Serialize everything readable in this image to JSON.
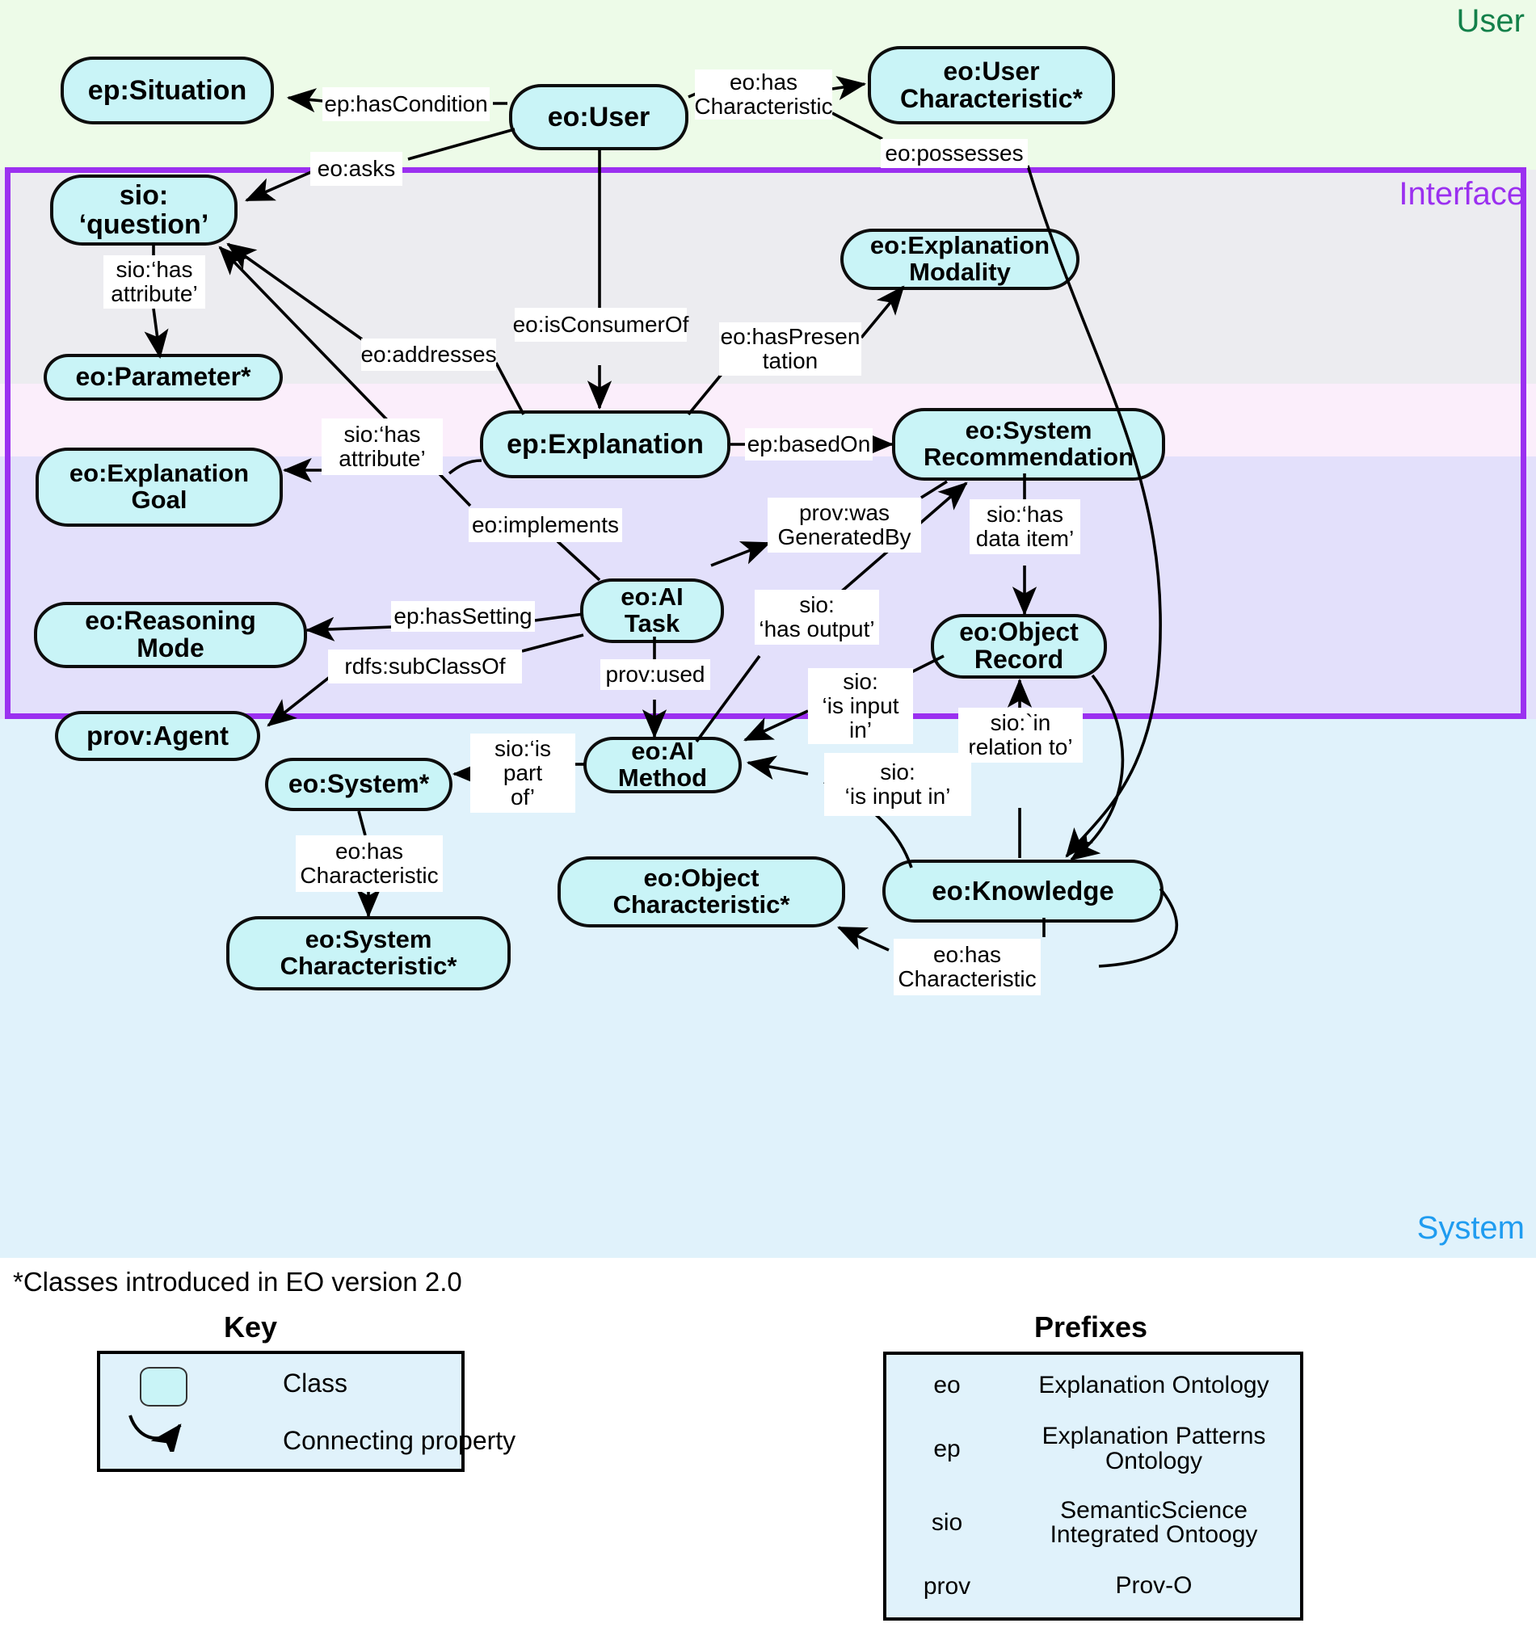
{
  "zones": {
    "user": {
      "label": "User",
      "color": "#13804a"
    },
    "interface": {
      "label": "Interface",
      "color": "#9b30f0"
    },
    "system": {
      "label": "System",
      "color": "#1f9cf0"
    }
  },
  "nodes": {
    "situation": "ep:Situation",
    "user": "eo:User",
    "user_characteristic_l1": "eo:User",
    "user_characteristic_l2": "Characteristic*",
    "question_l1": "sio:",
    "question_l2": "‘question’",
    "explanation_modality_l1": "eo:Explanation",
    "explanation_modality_l2": "Modality",
    "parameter": "eo:Parameter*",
    "explanation_goal_l1": "eo:Explanation",
    "explanation_goal_l2": "Goal",
    "explanation": "ep:Explanation",
    "system_recommendation_l1": "eo:System",
    "system_recommendation_l2": "Recommendation",
    "ai_task_l1": "eo:AI",
    "ai_task_l2": "Task",
    "object_record_l1": "eo:Object",
    "object_record_l2": "Record",
    "reasoning_mode_l1": "eo:Reasoning",
    "reasoning_mode_l2": "Mode",
    "prov_agent": "prov:Agent",
    "ai_method_l1": "eo:AI",
    "ai_method_l2": "Method",
    "system_star": "eo:System*",
    "object_characteristic_l1": "eo:Object",
    "object_characteristic_l2": "Characteristic*",
    "knowledge": "eo:Knowledge",
    "system_characteristic_l1": "eo:System",
    "system_characteristic_l2": "Characteristic*"
  },
  "properties": {
    "has_condition": "ep:hasCondition",
    "asks": "eo:asks",
    "has_characteristic_user_l1": "eo:has",
    "has_characteristic_user_l2": "Characteristic",
    "possesses": "eo:possesses",
    "sio_has_attribute_q_l1": "sio:‘has",
    "sio_has_attribute_q_l2": "attribute’",
    "addresses": "eo:addresses",
    "is_consumer_of": "eo:isConsumerOf",
    "has_presentation_l1": "eo:hasPresen",
    "has_presentation_l2": "tation",
    "sio_has_attribute_e_l1": "sio:‘has",
    "sio_has_attribute_e_l2": "attribute’",
    "based_on": "ep:basedOn",
    "implements": "eo:implements",
    "was_generated_by_l1": "prov:was",
    "was_generated_by_l2": "GeneratedBy",
    "sio_has_data_item_l1": "sio:‘has",
    "sio_has_data_item_l2": "data item’",
    "has_setting": "ep:hasSetting",
    "sub_class_of": "rdfs:subClassOf",
    "prov_used": "prov:used",
    "sio_has_output_l1": "sio:",
    "sio_has_output_l2": "‘has output’",
    "sio_is_input_in_a_l1": "sio:",
    "sio_is_input_in_a_l2": "‘is input",
    "sio_is_input_in_a_l3": "in’",
    "sio_in_relation_to_l1": "sio:`in",
    "sio_in_relation_to_l2": "relation to’",
    "sio_is_input_in_b_l1": "sio:",
    "sio_is_input_in_b_l2": "‘is input in’",
    "sio_is_part_of_l1": "sio:‘is",
    "sio_is_part_of_l2": "part",
    "sio_is_part_of_l3": "of’",
    "has_characteristic_sys_l1": "eo:has",
    "has_characteristic_sys_l2": "Characteristic",
    "has_characteristic_know_l1": "eo:has",
    "has_characteristic_know_l2": "Characteristic"
  },
  "footnote": "*Classes introduced in EO version 2.0",
  "key": {
    "title": "Key",
    "class_label": "Class",
    "property_label": "Connecting property"
  },
  "prefixes": {
    "title": "Prefixes",
    "rows": [
      {
        "key": "eo",
        "value": "Explanation Ontology"
      },
      {
        "key": "ep",
        "value": "Explanation Patterns Ontology"
      },
      {
        "key": "sio",
        "value": "SemanticScience Integrated Ontoogy"
      },
      {
        "key": "prov",
        "value": "Prov-O"
      }
    ]
  },
  "colors": {
    "node_fill": "#c9f4f7",
    "band_user": "#edfbe8",
    "band_interface_gray": "#ececf0",
    "band_interface_pink": "#fbeefb",
    "band_interface_lavender": "#e3e0fb",
    "band_system": "#e0f2fb",
    "interface_border": "#9b30f0"
  }
}
